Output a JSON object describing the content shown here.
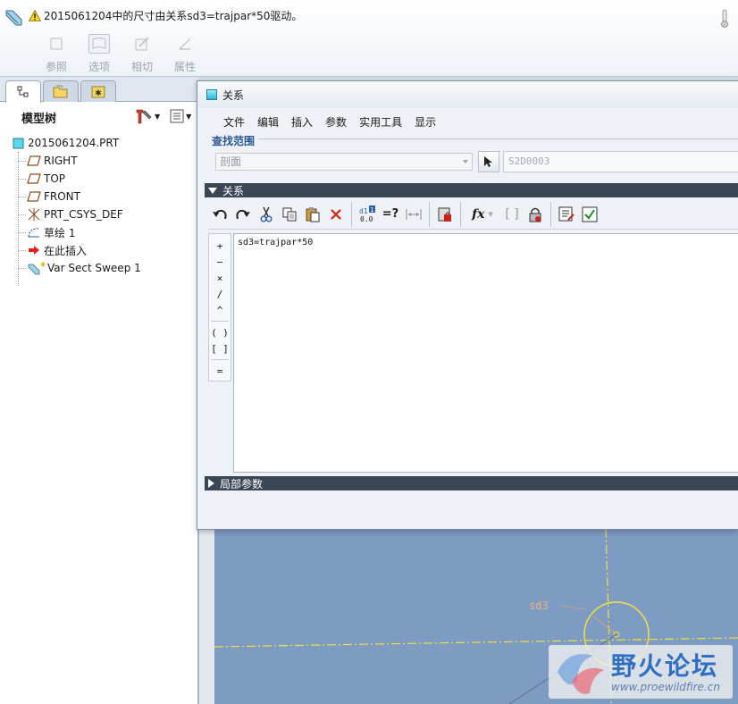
{
  "topbar": {
    "message": "2015061204中的尺寸由关系sd3=trajpar*50驱动。",
    "dashboard_buttons": [
      {
        "label": "参照",
        "icon": "reference-icon"
      },
      {
        "label": "选项",
        "icon": "options-icon"
      },
      {
        "label": "相切",
        "icon": "tangent-icon"
      },
      {
        "label": "属性",
        "icon": "properties-icon"
      }
    ]
  },
  "model_tree": {
    "title": "模型树",
    "root": "2015061204.PRT",
    "items": [
      {
        "label": "RIGHT",
        "icon": "datum-plane-icon"
      },
      {
        "label": "TOP",
        "icon": "datum-plane-icon"
      },
      {
        "label": "FRONT",
        "icon": "datum-plane-icon"
      },
      {
        "label": "PRT_CSYS_DEF",
        "icon": "csys-icon"
      },
      {
        "label": "草绘 1",
        "icon": "sketch-icon"
      },
      {
        "label": "在此插入",
        "icon": "insert-here-arrow-icon"
      },
      {
        "label": "Var Sect Sweep 1",
        "icon": "sweep-feature-icon"
      }
    ]
  },
  "dialog": {
    "title": "关系",
    "menu": [
      "文件",
      "编辑",
      "插入",
      "参数",
      "实用工具",
      "显示"
    ],
    "scope": {
      "legend": "查找范围",
      "select_value": "剖面",
      "item_value": "S2D0003"
    },
    "relations_section": "关系",
    "operators": [
      "+",
      "−",
      "×",
      "/",
      "^",
      "( )",
      "[ ]",
      "="
    ],
    "relations_text": "sd3=trajpar*50",
    "local_params_section": "局部参数"
  },
  "graphics": {
    "dimension_label": "sd3"
  },
  "watermark": {
    "title": "野火论坛",
    "url": "www.proewildfire.cn"
  },
  "colors": {
    "section_bar": "#3a4555",
    "graphics_bg": "#7d9bc3",
    "sketch_yellow": "#f2e23a"
  }
}
